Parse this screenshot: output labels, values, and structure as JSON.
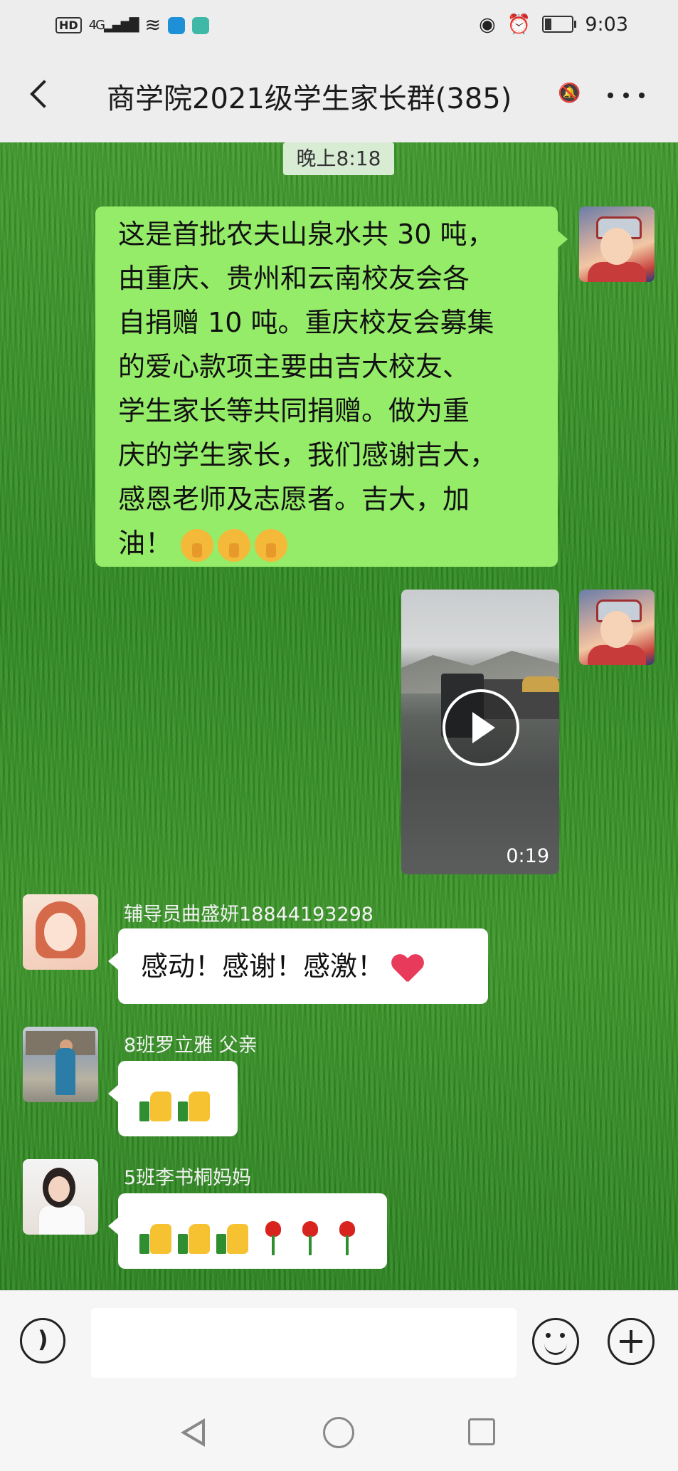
{
  "status_bar": {
    "network_badge": "HD",
    "network_type": "4G",
    "time": "9:03"
  },
  "header": {
    "back_label": "<",
    "title": "商学院2021级学生家长群(385)"
  },
  "chat": {
    "timestamp": "晚上8:18",
    "messages": [
      {
        "type": "text",
        "direction": "outgoing",
        "lines": [
          "这是首批农夫山泉水共 30 吨，",
          "由重庆、贵州和云南校友会各",
          "自捐赠 10 吨。重庆校友会募集",
          "的爱心款项主要由吉大校友、",
          "学生家长等共同捐赠。做为重",
          "庆的学生家长，我们感谢吉大，",
          "感恩老师及志愿者。吉大，加",
          "油！"
        ],
        "emojis": [
          "shush-face",
          "shush-face",
          "shush-face"
        ]
      },
      {
        "type": "video",
        "direction": "outgoing",
        "duration": "0:19"
      },
      {
        "type": "text",
        "direction": "incoming",
        "sender": "辅导员曲盛妍18844193298",
        "text": "感动！感谢！感激！",
        "emojis": [
          "red-heart"
        ]
      },
      {
        "type": "text",
        "direction": "incoming",
        "sender": "8班罗立雅 父亲",
        "emojis": [
          "thumbs-up",
          "thumbs-up"
        ]
      },
      {
        "type": "text",
        "direction": "incoming",
        "sender": "5班李书桐妈妈",
        "emojis": [
          "thumbs-up",
          "thumbs-up",
          "thumbs-up",
          "rose",
          "rose",
          "rose"
        ]
      }
    ]
  },
  "input_bar": {
    "placeholder": ""
  },
  "colors": {
    "outgoing_bubble": "#95ec69",
    "incoming_bubble": "#ffffff",
    "chat_background": "#3a9428"
  }
}
